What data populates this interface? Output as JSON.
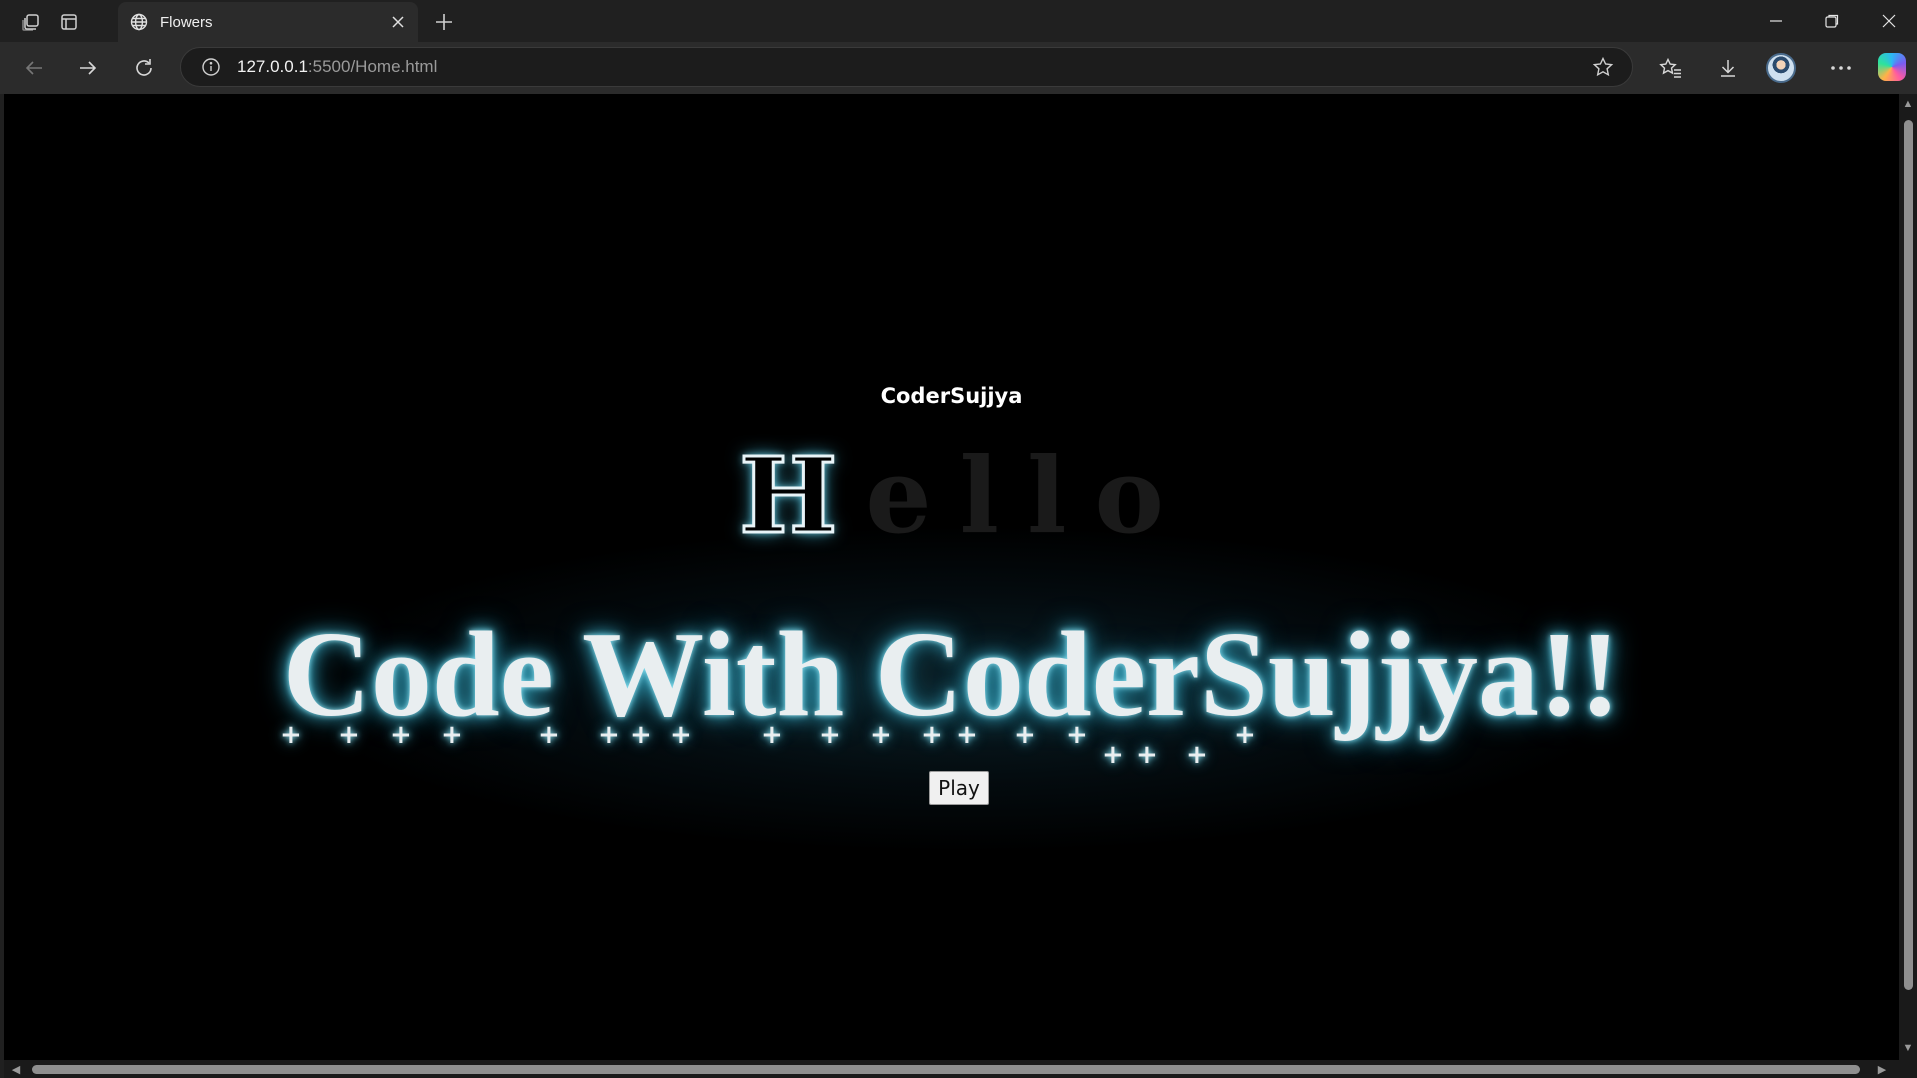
{
  "browser": {
    "tab": {
      "title": "Flowers"
    },
    "address": {
      "host": "127.0.0.1",
      "rest": ":5500/Home.html"
    }
  },
  "page": {
    "brand": "CoderSujjya",
    "hello_letters": [
      "H",
      "e",
      "l",
      "l",
      "o"
    ],
    "hello_lit_index": 0,
    "headline": "Code With CoderSujjya!!",
    "play_label": "Play"
  },
  "colors": {
    "page_background": "#000000",
    "glow": "#3fb6d1",
    "headline_text": "#e9eef0"
  },
  "icons": {
    "workspaces": "workspaces-icon",
    "tab_actions": "tab-actions-icon",
    "favicon": "globe-icon",
    "close_tab": "close-icon",
    "new_tab": "plus-icon",
    "back": "back-arrow-icon",
    "forward": "forward-arrow-icon",
    "refresh": "refresh-icon",
    "site_info": "info-icon",
    "favorite": "star-icon",
    "favorites": "favorites-icon",
    "downloads": "download-icon",
    "more": "more-icon"
  }
}
